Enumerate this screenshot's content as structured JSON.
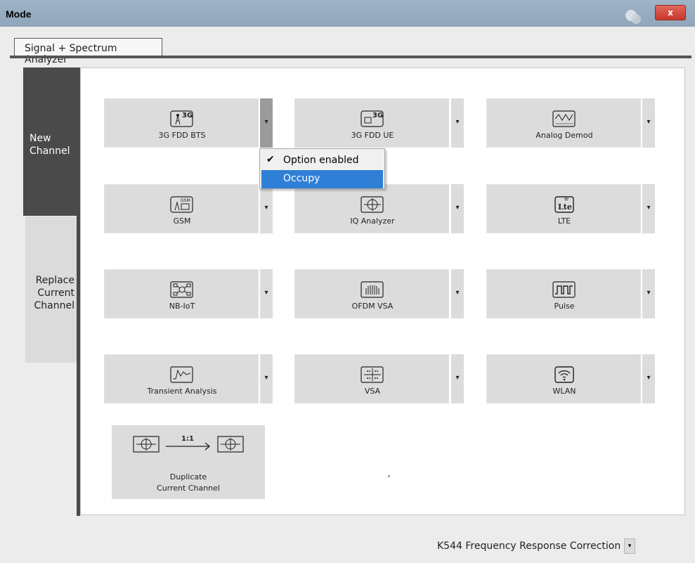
{
  "window": {
    "title": "Mode",
    "close_label": "x"
  },
  "tabs": [
    {
      "label": "Signal + Spectrum Analyzer"
    }
  ],
  "side_tabs": {
    "new_channel": "New\nChannel",
    "replace_channel": "Replace\nCurrent\nChannel"
  },
  "apps": [
    {
      "label": "3G FDD BTS",
      "icon": "3g-bts-icon"
    },
    {
      "label": "3G FDD UE",
      "icon": "3g-ue-icon"
    },
    {
      "label": "Analog Demod",
      "icon": "analog-demod-icon"
    },
    {
      "label": "GSM",
      "icon": "gsm-icon"
    },
    {
      "label": "IQ Analyzer",
      "icon": "iq-analyzer-icon"
    },
    {
      "label": "LTE",
      "icon": "lte-icon"
    },
    {
      "label": "NB-IoT",
      "icon": "nb-iot-icon"
    },
    {
      "label": "OFDM VSA",
      "icon": "ofdm-vsa-icon"
    },
    {
      "label": "Pulse",
      "icon": "pulse-icon"
    },
    {
      "label": "Transient Analysis",
      "icon": "transient-analysis-icon"
    },
    {
      "label": "VSA",
      "icon": "vsa-icon"
    },
    {
      "label": "WLAN",
      "icon": "wlan-icon"
    }
  ],
  "dropdown_glyph": "▾",
  "context_menu": {
    "items": [
      {
        "label": "Option enabled",
        "checked": true,
        "check_glyph": "✔"
      },
      {
        "label": "Occupy",
        "selected": true
      }
    ]
  },
  "duplicate": {
    "label": "Duplicate\nCurrent Channel",
    "ratio_label": "1:1"
  },
  "footer": {
    "option_label": "K544 Frequency Response Correction"
  },
  "colors": {
    "accent": "#2f7fd6",
    "active_tab": "#4a4a4a",
    "tile": "#dcdcdc",
    "titlebar": "#9fb4c7"
  }
}
